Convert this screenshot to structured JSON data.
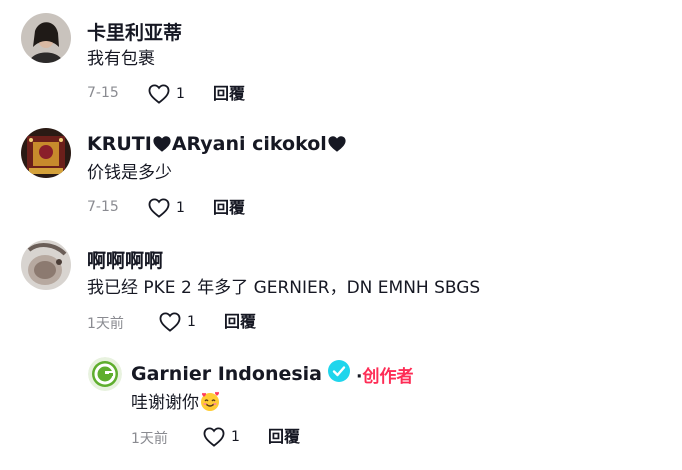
{
  "comments": [
    {
      "username": "卡里利亚蒂",
      "text": "我有包裹",
      "date": "7-15",
      "likes": "1",
      "reply_label": "回覆"
    },
    {
      "username_part1": "KRUTI",
      "username_part2": "ARyani cikokol",
      "text": "价钱是多少",
      "date": "7-15",
      "likes": "1",
      "reply_label": "回覆"
    },
    {
      "username": "啊啊啊啊",
      "text": "我已经 PKE 2 年多了 GERNIER，DN EMNH SBGS",
      "date": "1天前",
      "likes": "1",
      "reply_label": "回覆"
    }
  ],
  "reply": {
    "username": "Garnier Indonesia",
    "creator_separator": "·",
    "creator_label": "创作者",
    "text": "哇谢谢你",
    "date": "1天前",
    "likes": "1",
    "reply_label": "回覆"
  },
  "colors": {
    "accent": "#fe2c55",
    "verified": "#20d5ec",
    "muted": "#8a8b91"
  }
}
